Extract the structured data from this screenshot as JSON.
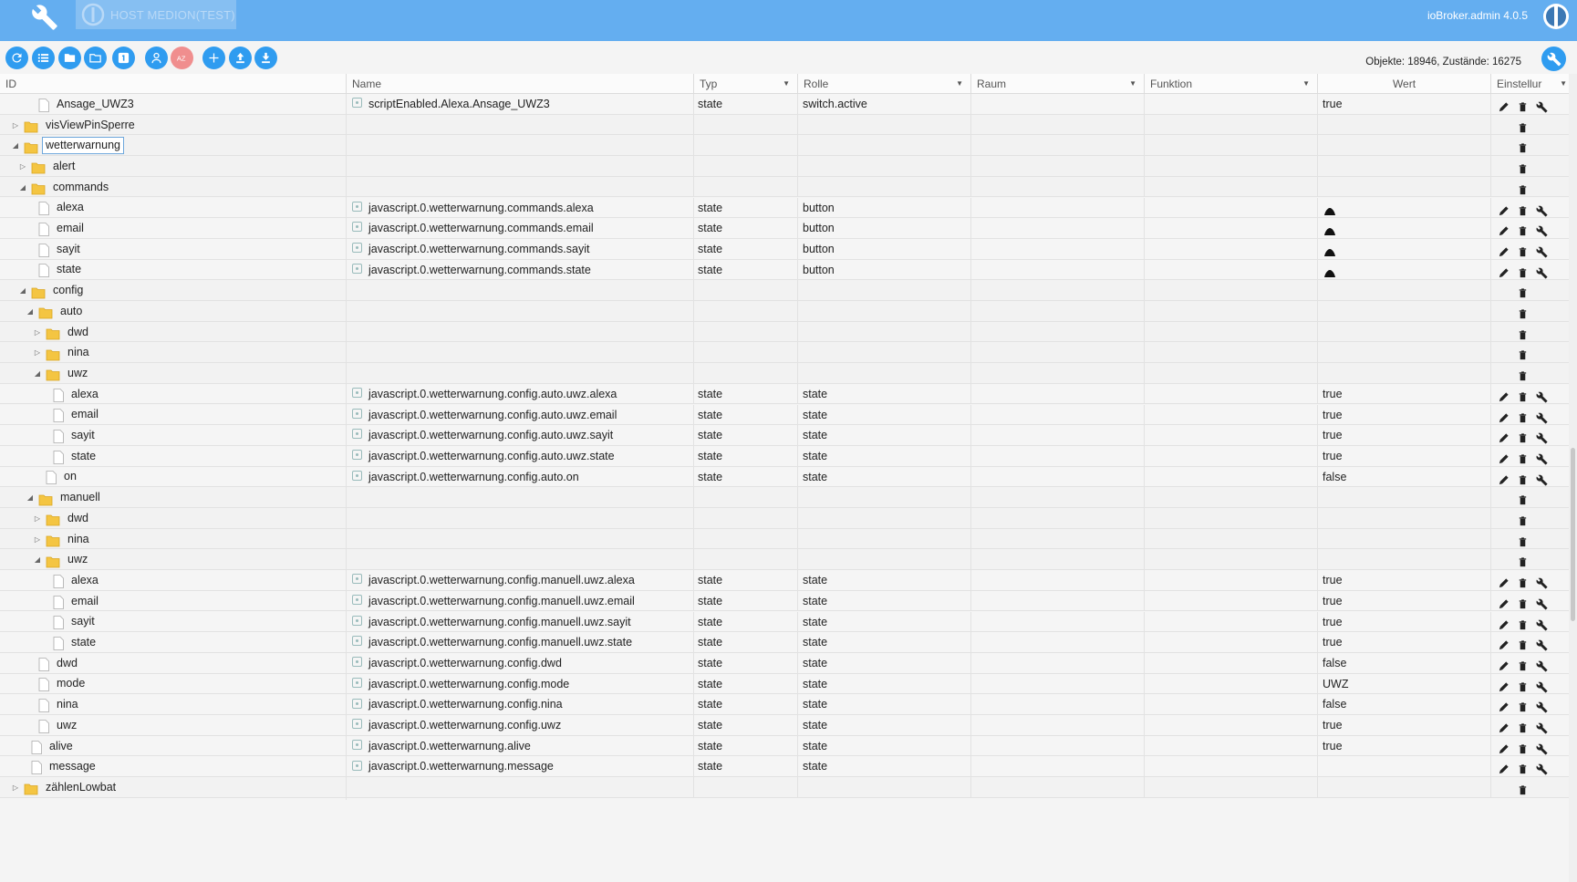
{
  "topbar": {
    "host_tab_label": "HOST MEDION(TEST)",
    "admin_label": "ioBroker.admin 4.0.5",
    "color": "#64aef0"
  },
  "toolbar": {
    "buttons": [
      {
        "name": "refresh",
        "icon": "refresh-icon"
      },
      {
        "name": "list-view",
        "icon": "list-icon"
      },
      {
        "name": "collapse-folders",
        "icon": "folder-closed-icon"
      },
      {
        "name": "expand-folders",
        "icon": "folder-open-icon"
      },
      {
        "name": "toggle-expert",
        "icon": "number-1-icon",
        "label": "1"
      },
      {
        "name": "edit-roles",
        "icon": "person-icon"
      },
      {
        "name": "sort-az",
        "icon": "sort-az-icon",
        "label": "AZ"
      },
      {
        "name": "add",
        "icon": "plus-icon"
      },
      {
        "name": "upload",
        "icon": "upload-icon"
      },
      {
        "name": "download",
        "icon": "download-icon"
      }
    ],
    "counts": "Objekte: 18946, Zustände: 16275"
  },
  "columns": {
    "id": "ID",
    "name": "Name",
    "typ": "Typ",
    "rolle": "Rolle",
    "raum": "Raum",
    "funktion": "Funktion",
    "wert": "Wert",
    "einstellungen": "Einstellur"
  },
  "rows": [
    {
      "level": 3,
      "kind": "file",
      "toggle": "",
      "id": "Ansage_UWZ3",
      "name": "scriptEnabled.Alexa.Ansage_UWZ3",
      "typ": "state",
      "rolle": "switch.active",
      "wert": "true",
      "actions": "full"
    },
    {
      "level": 1,
      "kind": "folder",
      "toggle": "▷",
      "id": "visViewPinSperre",
      "name": "",
      "typ": "",
      "rolle": "",
      "wert": "",
      "actions": "delete"
    },
    {
      "level": 1,
      "kind": "folder",
      "toggle": "◢",
      "id": "wetterwarnung",
      "selected": true,
      "name": "",
      "typ": "",
      "rolle": "",
      "wert": "",
      "actions": "delete"
    },
    {
      "level": 2,
      "kind": "folder",
      "toggle": "▷",
      "id": "alert",
      "name": "",
      "typ": "",
      "rolle": "",
      "wert": "",
      "actions": "delete"
    },
    {
      "level": 2,
      "kind": "folder",
      "toggle": "◢",
      "id": "commands",
      "name": "",
      "typ": "",
      "rolle": "",
      "wert": "",
      "actions": "delete"
    },
    {
      "level": 3,
      "kind": "file",
      "toggle": "",
      "id": "alexa",
      "name": "javascript.0.wetterwarnung.commands.alexa",
      "typ": "state",
      "rolle": "button",
      "wert": "",
      "button": true,
      "actions": "full"
    },
    {
      "level": 3,
      "kind": "file",
      "toggle": "",
      "id": "email",
      "name": "javascript.0.wetterwarnung.commands.email",
      "typ": "state",
      "rolle": "button",
      "wert": "",
      "button": true,
      "actions": "full"
    },
    {
      "level": 3,
      "kind": "file",
      "toggle": "",
      "id": "sayit",
      "name": "javascript.0.wetterwarnung.commands.sayit",
      "typ": "state",
      "rolle": "button",
      "wert": "",
      "button": true,
      "actions": "full"
    },
    {
      "level": 3,
      "kind": "file",
      "toggle": "",
      "id": "state",
      "name": "javascript.0.wetterwarnung.commands.state",
      "typ": "state",
      "rolle": "button",
      "wert": "",
      "button": true,
      "actions": "full"
    },
    {
      "level": 2,
      "kind": "folder",
      "toggle": "◢",
      "id": "config",
      "name": "",
      "typ": "",
      "rolle": "",
      "wert": "",
      "actions": "delete"
    },
    {
      "level": 3,
      "kind": "folder",
      "toggle": "◢",
      "id": "auto",
      "name": "",
      "typ": "",
      "rolle": "",
      "wert": "",
      "actions": "delete"
    },
    {
      "level": 4,
      "kind": "folder",
      "toggle": "▷",
      "id": "dwd",
      "name": "",
      "typ": "",
      "rolle": "",
      "wert": "",
      "actions": "delete"
    },
    {
      "level": 4,
      "kind": "folder",
      "toggle": "▷",
      "id": "nina",
      "name": "",
      "typ": "",
      "rolle": "",
      "wert": "",
      "actions": "delete"
    },
    {
      "level": 4,
      "kind": "folder",
      "toggle": "◢",
      "id": "uwz",
      "name": "",
      "typ": "",
      "rolle": "",
      "wert": "",
      "actions": "delete"
    },
    {
      "level": 5,
      "kind": "file",
      "toggle": "",
      "id": "alexa",
      "name": "javascript.0.wetterwarnung.config.auto.uwz.alexa",
      "typ": "state",
      "rolle": "state",
      "wert": "true",
      "actions": "full"
    },
    {
      "level": 5,
      "kind": "file",
      "toggle": "",
      "id": "email",
      "name": "javascript.0.wetterwarnung.config.auto.uwz.email",
      "typ": "state",
      "rolle": "state",
      "wert": "true",
      "actions": "full"
    },
    {
      "level": 5,
      "kind": "file",
      "toggle": "",
      "id": "sayit",
      "name": "javascript.0.wetterwarnung.config.auto.uwz.sayit",
      "typ": "state",
      "rolle": "state",
      "wert": "true",
      "actions": "full"
    },
    {
      "level": 5,
      "kind": "file",
      "toggle": "",
      "id": "state",
      "name": "javascript.0.wetterwarnung.config.auto.uwz.state",
      "typ": "state",
      "rolle": "state",
      "wert": "true",
      "actions": "full"
    },
    {
      "level": 4,
      "kind": "file",
      "toggle": "",
      "id": "on",
      "name": "javascript.0.wetterwarnung.config.auto.on",
      "typ": "state",
      "rolle": "state",
      "wert": "false",
      "actions": "full"
    },
    {
      "level": 3,
      "kind": "folder",
      "toggle": "◢",
      "id": "manuell",
      "name": "",
      "typ": "",
      "rolle": "",
      "wert": "",
      "actions": "delete"
    },
    {
      "level": 4,
      "kind": "folder",
      "toggle": "▷",
      "id": "dwd",
      "name": "",
      "typ": "",
      "rolle": "",
      "wert": "",
      "actions": "delete"
    },
    {
      "level": 4,
      "kind": "folder",
      "toggle": "▷",
      "id": "nina",
      "name": "",
      "typ": "",
      "rolle": "",
      "wert": "",
      "actions": "delete"
    },
    {
      "level": 4,
      "kind": "folder",
      "toggle": "◢",
      "id": "uwz",
      "name": "",
      "typ": "",
      "rolle": "",
      "wert": "",
      "actions": "delete"
    },
    {
      "level": 5,
      "kind": "file",
      "toggle": "",
      "id": "alexa",
      "name": "javascript.0.wetterwarnung.config.manuell.uwz.alexa",
      "typ": "state",
      "rolle": "state",
      "wert": "true",
      "actions": "full"
    },
    {
      "level": 5,
      "kind": "file",
      "toggle": "",
      "id": "email",
      "name": "javascript.0.wetterwarnung.config.manuell.uwz.email",
      "typ": "state",
      "rolle": "state",
      "wert": "true",
      "actions": "full"
    },
    {
      "level": 5,
      "kind": "file",
      "toggle": "",
      "id": "sayit",
      "name": "javascript.0.wetterwarnung.config.manuell.uwz.sayit",
      "typ": "state",
      "rolle": "state",
      "wert": "true",
      "actions": "full"
    },
    {
      "level": 5,
      "kind": "file",
      "toggle": "",
      "id": "state",
      "name": "javascript.0.wetterwarnung.config.manuell.uwz.state",
      "typ": "state",
      "rolle": "state",
      "wert": "true",
      "actions": "full"
    },
    {
      "level": 3,
      "kind": "file",
      "toggle": "",
      "id": "dwd",
      "name": "javascript.0.wetterwarnung.config.dwd",
      "typ": "state",
      "rolle": "state",
      "wert": "false",
      "actions": "full"
    },
    {
      "level": 3,
      "kind": "file",
      "toggle": "",
      "id": "mode",
      "name": "javascript.0.wetterwarnung.config.mode",
      "typ": "state",
      "rolle": "state",
      "wert": "UWZ",
      "actions": "full"
    },
    {
      "level": 3,
      "kind": "file",
      "toggle": "",
      "id": "nina",
      "name": "javascript.0.wetterwarnung.config.nina",
      "typ": "state",
      "rolle": "state",
      "wert": "false",
      "actions": "full"
    },
    {
      "level": 3,
      "kind": "file",
      "toggle": "",
      "id": "uwz",
      "name": "javascript.0.wetterwarnung.config.uwz",
      "typ": "state",
      "rolle": "state",
      "wert": "true",
      "actions": "full"
    },
    {
      "level": 2,
      "kind": "file",
      "toggle": "",
      "id": "alive",
      "name": "javascript.0.wetterwarnung.alive",
      "typ": "state",
      "rolle": "state",
      "wert": "true",
      "actions": "full"
    },
    {
      "level": 2,
      "kind": "file",
      "toggle": "",
      "id": "message",
      "name": "javascript.0.wetterwarnung.message",
      "typ": "state",
      "rolle": "state",
      "wert": "",
      "actions": "full"
    },
    {
      "level": 1,
      "kind": "folder",
      "toggle": "▷",
      "id": "zählenLowbat",
      "name": "",
      "typ": "",
      "rolle": "",
      "wert": "",
      "actions": "delete"
    }
  ]
}
